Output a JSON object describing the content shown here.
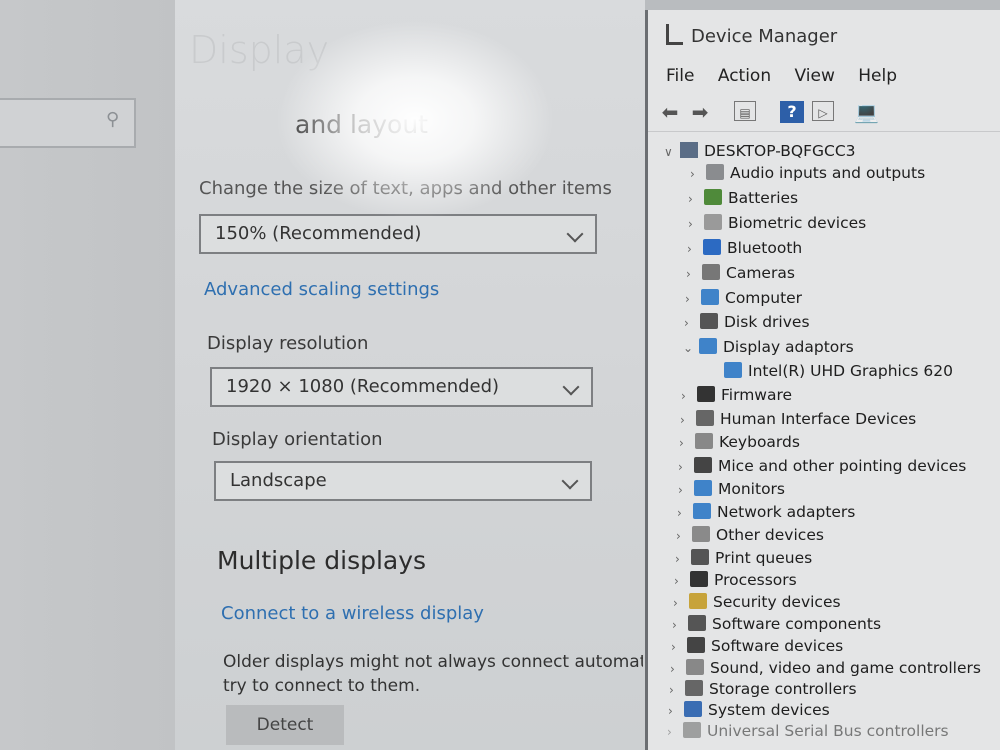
{
  "settings": {
    "title": "Display",
    "section_scale": "and layout",
    "scale_label": "Change the size of text, apps and other items",
    "scale_value": "150% (Recommended)",
    "advanced_link": "Advanced scaling settings",
    "resolution_label": "Display resolution",
    "resolution_value": "1920 × 1080 (Recommended)",
    "orientation_label": "Display orientation",
    "orientation_value": "Landscape",
    "multiple_title": "Multiple displays",
    "wireless_link": "Connect to a wireless display",
    "older_line1": "Older displays might not always connect automatic",
    "older_line2": "try to connect to them.",
    "detect_label": "Detect"
  },
  "device_manager": {
    "title": "Device Manager",
    "menu": [
      "File",
      "Action",
      "View",
      "Help"
    ],
    "root": "DESKTOP-BQFGCC3",
    "items": [
      "Audio inputs and outputs",
      "Batteries",
      "Biometric devices",
      "Bluetooth",
      "Cameras",
      "Computer",
      "Disk drives",
      "Display adaptors",
      "Intel(R) UHD Graphics 620",
      "Firmware",
      "Human Interface Devices",
      "Keyboards",
      "Mice and other pointing devices",
      "Monitors",
      "Network adapters",
      "Other devices",
      "Print queues",
      "Processors",
      "Security devices",
      "Software components",
      "Software devices",
      "Sound, video and game controllers",
      "Storage controllers",
      "System devices",
      "Universal Serial Bus controllers"
    ]
  },
  "colors": {
    "link": "#2e6fb0",
    "accent": "#2d5fa8"
  },
  "icons": [
    "search-icon",
    "chevron-down-icon",
    "back-arrow-icon",
    "forward-arrow-icon",
    "properties-icon",
    "help-icon",
    "update-driver-icon",
    "monitor-icon"
  ]
}
